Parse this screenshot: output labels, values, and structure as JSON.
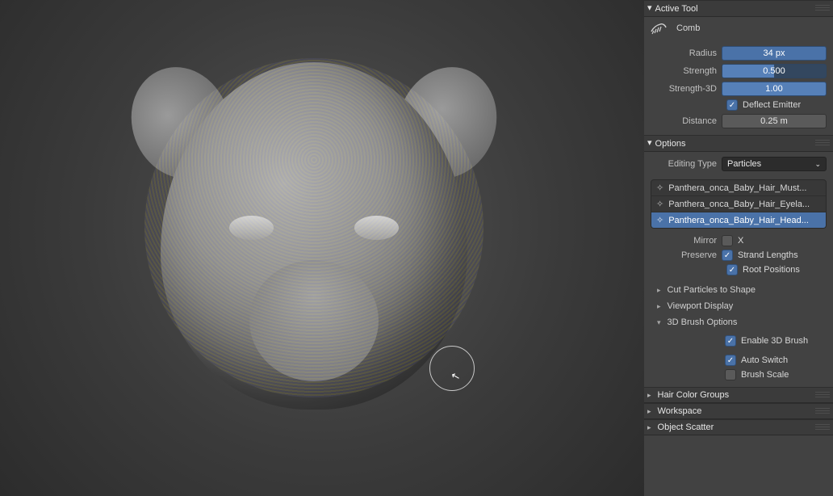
{
  "panels": {
    "active_tool": {
      "title": "Active Tool",
      "tool_name": "Comb",
      "radius_label": "Radius",
      "radius_value": "34 px",
      "strength_label": "Strength",
      "strength_value": "0.500",
      "strength3d_label": "Strength-3D",
      "strength3d_value": "1.00",
      "deflect_label": "Deflect Emitter",
      "distance_label": "Distance",
      "distance_value": "0.25 m"
    },
    "options": {
      "title": "Options",
      "editing_type_label": "Editing Type",
      "editing_type_value": "Particles",
      "systems": [
        "Panthera_onca_Baby_Hair_Must...",
        "Panthera_onca_Baby_Hair_Eyela...",
        "Panthera_onca_Baby_Hair_Head..."
      ],
      "mirror_label": "Mirror",
      "mirror_x": "X",
      "preserve_label": "Preserve",
      "preserve_strand": "Strand Lengths",
      "preserve_root": "Root Positions",
      "cut_particles": "Cut Particles to Shape",
      "viewport_display": "Viewport Display",
      "brush3d": {
        "title": "3D Brush Options",
        "enable": "Enable 3D Brush",
        "auto_switch": "Auto Switch",
        "brush_scale": "Brush Scale"
      }
    },
    "hair_color_groups": "Hair Color Groups",
    "workspace": "Workspace",
    "object_scatter": "Object Scatter"
  }
}
